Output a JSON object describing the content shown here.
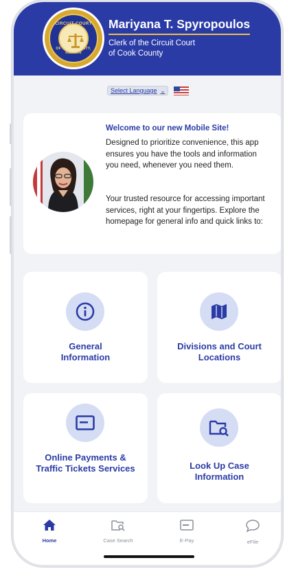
{
  "header": {
    "name": "Mariyana T. Spyropoulos",
    "office_line1": "Clerk of the Circuit Court",
    "office_line2": "of Cook County",
    "seal_text_top": "CIRCUIT COURT",
    "seal_text_bottom": "OF COOK COUNTY, ILLINOIS"
  },
  "language": {
    "label": "Select Language",
    "caret": "⌄"
  },
  "welcome": {
    "title": "Welcome to our new Mobile Site!",
    "paragraph1": "Designed to prioritize convenience, this app ensures you have the tools and information you need, whenever you need them.",
    "paragraph2": "Your trusted resource for accessing important services, right at your fingertips. Explore the homepage for general info and quick links to:"
  },
  "tiles": [
    {
      "label": "General Information",
      "icon": "info-icon"
    },
    {
      "label": "Divisions and Court Locations",
      "icon": "map-icon"
    },
    {
      "label": "Online Payments & Traffic Tickets Services",
      "icon": "payment-card-icon"
    },
    {
      "label": "Look Up Case Information",
      "icon": "folder-search-icon"
    }
  ],
  "nav": {
    "items": [
      {
        "label": "Home",
        "icon": "home-icon",
        "active": true
      },
      {
        "label": "Case Search",
        "icon": "case-search-icon",
        "active": false
      },
      {
        "label": "E-Pay",
        "icon": "epay-icon",
        "active": false
      },
      {
        "label": "eFile",
        "icon": "chat-bubble-icon",
        "active": false
      }
    ]
  },
  "colors": {
    "brand_blue": "#2a3ba6",
    "accent_gold": "#f0c24a",
    "icon_circle": "#d5ddf5",
    "background": "#f2f3f6"
  }
}
